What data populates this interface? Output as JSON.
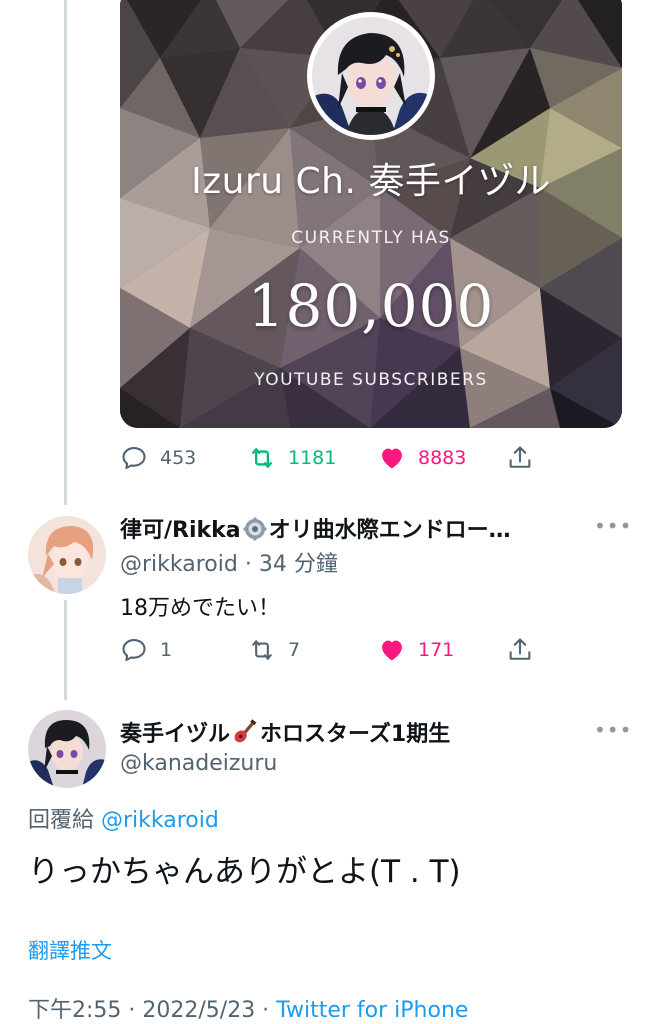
{
  "card": {
    "channel_name": "Izuru Ch. 奏手イヅル",
    "currently_has": "CURRENTLY HAS",
    "subscriber_count": "180,000",
    "subscribers_label": "YOUTUBE SUBSCRIBERS"
  },
  "main_actions": {
    "replies": "453",
    "retweets": "1181",
    "likes": "8883"
  },
  "reply": {
    "display_name": "律可/Rikka",
    "display_name_rest": "オリ曲水際エンドロー…",
    "handle": "@rikkaroid",
    "time": "· 34 分鐘",
    "text": "18万めでたい！",
    "actions": {
      "replies": "1",
      "retweets": "7",
      "likes": "171"
    }
  },
  "focal": {
    "display_name": "奏手イヅル",
    "display_name_rest": "ホロスターズ1期生",
    "handle": "@kanadeizuru",
    "replying_prefix": "回覆給",
    "replying_to": "@rikkaroid",
    "text": "りっかちゃんありがとよ(T . T)",
    "translate": "翻譯推文",
    "timestamp": "下午2:55 · 2022/5/23 ·",
    "source": "Twitter for iPhone"
  },
  "more_label": "•••",
  "colors": {
    "retweet": "#00ba7c",
    "like": "#f91880",
    "link": "#1d9bf0",
    "secondary_text": "#536471"
  },
  "icons": [
    "reply-icon",
    "retweet-icon",
    "heart-icon",
    "share-icon",
    "gear-emoji-icon",
    "guitar-emoji-icon",
    "more-icon"
  ]
}
